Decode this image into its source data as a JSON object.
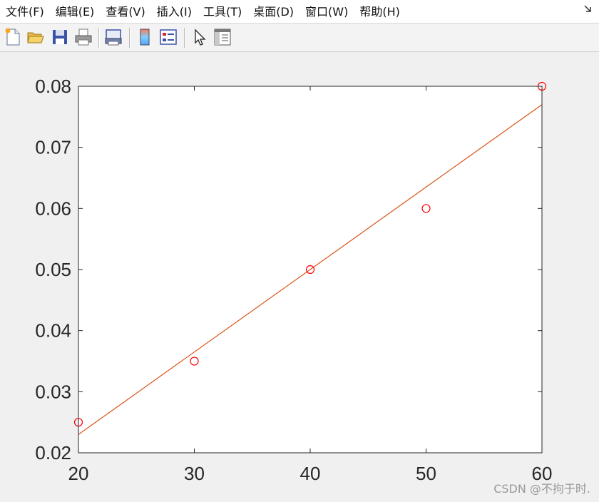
{
  "menu": {
    "items": [
      {
        "id": "file",
        "label": "文件(F)"
      },
      {
        "id": "edit",
        "label": "编辑(E)"
      },
      {
        "id": "view",
        "label": "查看(V)"
      },
      {
        "id": "insert",
        "label": "插入(I)"
      },
      {
        "id": "tools",
        "label": "工具(T)"
      },
      {
        "id": "desktop",
        "label": "桌面(D)"
      },
      {
        "id": "window",
        "label": "窗口(W)"
      },
      {
        "id": "help",
        "label": "帮助(H)"
      }
    ]
  },
  "toolbar": {
    "buttons": [
      "new-file-icon",
      "open-folder-icon",
      "save-icon",
      "print-icon",
      "print-preview-icon",
      "colorbar-icon",
      "legend-icon",
      "pointer-arrow-icon",
      "property-inspector-icon"
    ]
  },
  "chart_data": {
    "type": "scatter",
    "title": "",
    "xlabel": "",
    "ylabel": "",
    "xlim": [
      20,
      60
    ],
    "ylim": [
      0.02,
      0.08
    ],
    "xticks": [
      "20",
      "30",
      "40",
      "50",
      "60"
    ],
    "yticks": [
      "0.02",
      "0.03",
      "0.04",
      "0.05",
      "0.06",
      "0.07",
      "0.08"
    ],
    "grid": false,
    "series": [
      {
        "type": "scatter",
        "marker": "circle",
        "color": "#ff0000",
        "x": [
          20,
          30,
          40,
          50,
          60
        ],
        "y": [
          0.025,
          0.035,
          0.05,
          0.06,
          0.08
        ]
      },
      {
        "type": "line",
        "color": "#d95319",
        "x": [
          20,
          60
        ],
        "y": [
          0.023,
          0.077
        ]
      }
    ]
  },
  "watermark": "CSDN @不拘于时."
}
